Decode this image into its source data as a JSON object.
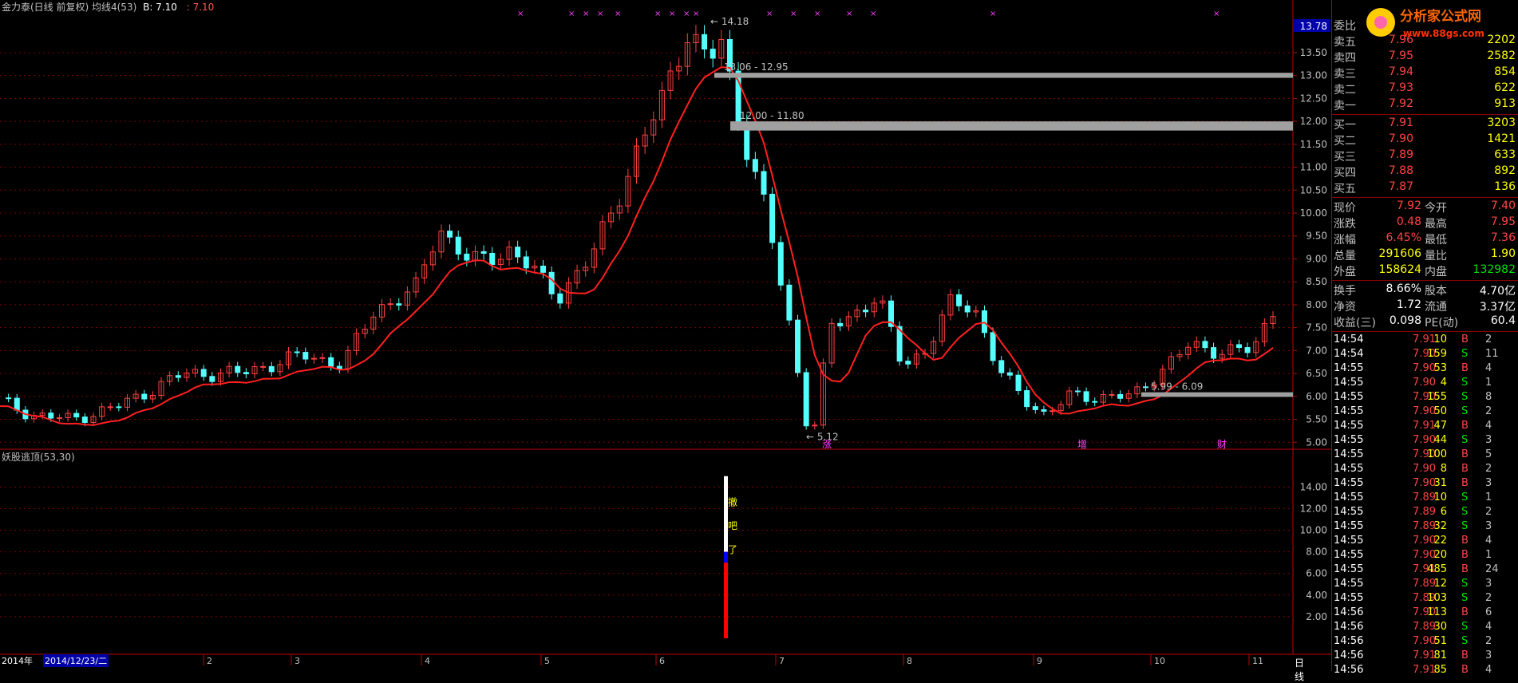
{
  "header": {
    "title": "金力泰(日线 前复权) 均线4(53)",
    "b_value": "B: 7.10",
    "b2_value": ": 7.10"
  },
  "price_axis_top": "13.78",
  "price_ticks": [
    "13.50",
    "13.00",
    "12.50",
    "12.00",
    "11.50",
    "11.00",
    "10.50",
    "10.00",
    "9.50",
    "9.00",
    "8.50",
    "8.00",
    "7.50",
    "7.00",
    "6.50",
    "6.00",
    "5.50",
    "5.00"
  ],
  "annotations": {
    "high": "14.18",
    "low": "5.12",
    "gap1": "13.06 - 12.95",
    "gap2": "12.00 - 11.80",
    "gap3": "5.99 - 6.09",
    "markers": [
      "涨",
      "增",
      "财"
    ]
  },
  "indicator": {
    "title": "妖股逃顶(53,30)",
    "ticks": [
      "14.00",
      "12.00",
      "10.00",
      "8.00",
      "6.00",
      "4.00",
      "2.00"
    ],
    "chars": [
      "撤",
      "吧",
      "了"
    ]
  },
  "xaxis": {
    "year": "2014年",
    "date": "2014/12/23/二",
    "months": [
      "2",
      "3",
      "4",
      "5",
      "6",
      "7",
      "8",
      "9",
      "10",
      "11"
    ],
    "period": "日线"
  },
  "quote": {
    "ratio_label": "委比",
    "asks": [
      {
        "label": "卖五",
        "price": "7.96",
        "vol": "2202"
      },
      {
        "label": "卖四",
        "price": "7.95",
        "vol": "2582"
      },
      {
        "label": "卖三",
        "price": "7.94",
        "vol": "854"
      },
      {
        "label": "卖二",
        "price": "7.93",
        "vol": "622"
      },
      {
        "label": "卖一",
        "price": "7.92",
        "vol": "913"
      }
    ],
    "bids": [
      {
        "label": "买一",
        "price": "7.91",
        "vol": "3203"
      },
      {
        "label": "买二",
        "price": "7.90",
        "vol": "1421"
      },
      {
        "label": "买三",
        "price": "7.89",
        "vol": "633"
      },
      {
        "label": "买四",
        "price": "7.88",
        "vol": "892"
      },
      {
        "label": "买五",
        "price": "7.87",
        "vol": "136"
      }
    ],
    "stats": [
      {
        "l1": "现价",
        "v1": "7.92",
        "l2": "今开",
        "v2": "7.40"
      },
      {
        "l1": "涨跌",
        "v1": "0.48",
        "l2": "最高",
        "v2": "7.95"
      },
      {
        "l1": "涨幅",
        "v1": "6.45%",
        "l2": "最低",
        "v2": "7.36"
      },
      {
        "l1": "总量",
        "v1": "291606",
        "l2": "量比",
        "v2": "1.90"
      },
      {
        "l1": "外盘",
        "v1": "158624",
        "l2": "内盘",
        "v2": "132982"
      }
    ],
    "stats2": [
      {
        "l1": "换手",
        "v1": "8.66%",
        "l2": "股本",
        "v2": "4.70亿"
      },
      {
        "l1": "净资",
        "v1": "1.72",
        "l2": "流通",
        "v2": "3.37亿"
      },
      {
        "l1": "收益(三)",
        "v1": "0.098",
        "l2": "PE(动)",
        "v2": "60.4"
      }
    ]
  },
  "ticks": [
    {
      "t": "14:54",
      "p": "7.91",
      "v": "10",
      "s": "B",
      "n": "2"
    },
    {
      "t": "14:54",
      "p": "7.90",
      "v": "159",
      "s": "S",
      "n": "11"
    },
    {
      "t": "14:55",
      "p": "7.90",
      "v": "53",
      "s": "B",
      "n": "4"
    },
    {
      "t": "14:55",
      "p": "7.90",
      "v": "4",
      "s": "S",
      "n": "1"
    },
    {
      "t": "14:55",
      "p": "7.90",
      "v": "155",
      "s": "S",
      "n": "8"
    },
    {
      "t": "14:55",
      "p": "7.90",
      "v": "50",
      "s": "S",
      "n": "2"
    },
    {
      "t": "14:55",
      "p": "7.91",
      "v": "47",
      "s": "B",
      "n": "4"
    },
    {
      "t": "14:55",
      "p": "7.90",
      "v": "44",
      "s": "S",
      "n": "3"
    },
    {
      "t": "14:55",
      "p": "7.90",
      "v": "100",
      "s": "B",
      "n": "5"
    },
    {
      "t": "14:55",
      "p": "7.90",
      "v": "8",
      "s": "B",
      "n": "2"
    },
    {
      "t": "14:55",
      "p": "7.90",
      "v": "31",
      "s": "B",
      "n": "3"
    },
    {
      "t": "14:55",
      "p": "7.89",
      "v": "10",
      "s": "S",
      "n": "1"
    },
    {
      "t": "14:55",
      "p": "7.89",
      "v": "6",
      "s": "S",
      "n": "2"
    },
    {
      "t": "14:55",
      "p": "7.89",
      "v": "32",
      "s": "S",
      "n": "3"
    },
    {
      "t": "14:55",
      "p": "7.90",
      "v": "22",
      "s": "B",
      "n": "4"
    },
    {
      "t": "14:55",
      "p": "7.90",
      "v": "20",
      "s": "B",
      "n": "1"
    },
    {
      "t": "14:55",
      "p": "7.91",
      "v": "485",
      "s": "B",
      "n": "24"
    },
    {
      "t": "14:55",
      "p": "7.89",
      "v": "12",
      "s": "S",
      "n": "3"
    },
    {
      "t": "14:55",
      "p": "7.89",
      "v": "103",
      "s": "S",
      "n": "2"
    },
    {
      "t": "14:56",
      "p": "7.90",
      "v": "113",
      "s": "B",
      "n": "6"
    },
    {
      "t": "14:56",
      "p": "7.89",
      "v": "30",
      "s": "S",
      "n": "4"
    },
    {
      "t": "14:56",
      "p": "7.90",
      "v": "51",
      "s": "S",
      "n": "2"
    },
    {
      "t": "14:56",
      "p": "7.91",
      "v": "81",
      "s": "B",
      "n": "3"
    },
    {
      "t": "14:56",
      "p": "7.91",
      "v": "85",
      "s": "B",
      "n": "4"
    }
  ],
  "colors": {
    "up": "#ff4040",
    "down": "#54ffff",
    "ma": "#ff2020",
    "grid": "#800000",
    "gap": "#a0a0a0"
  }
}
